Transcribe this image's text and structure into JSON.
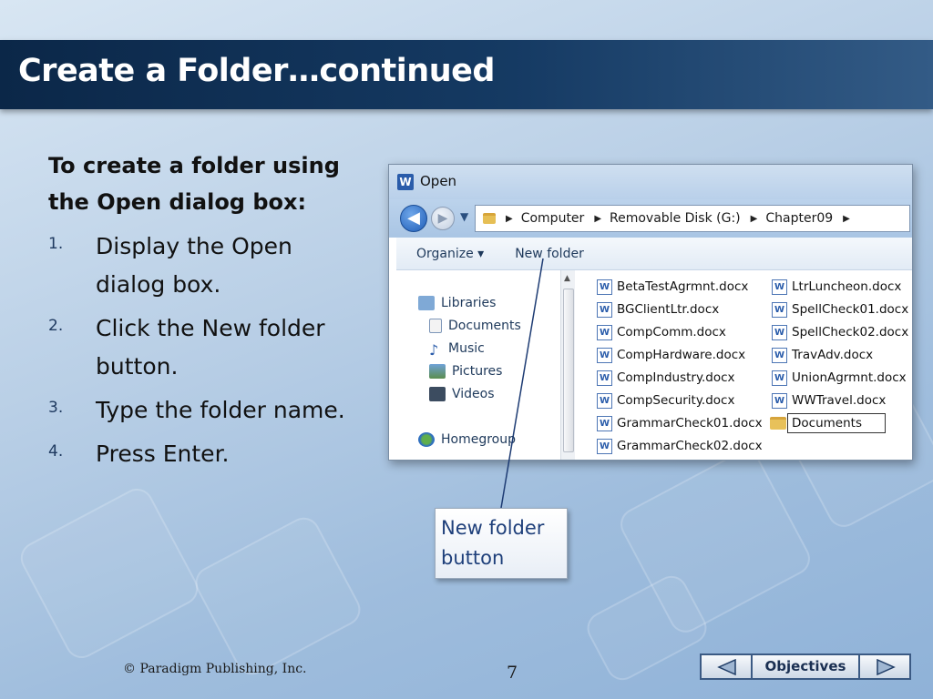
{
  "slide": {
    "title": "Create a Folder…continued",
    "intro": "To create a folder using the Open dialog box:",
    "steps": [
      {
        "num": "1.",
        "text": "Display the Open dialog box."
      },
      {
        "num": "2.",
        "text": "Click the New folder button."
      },
      {
        "num": "3.",
        "text": "Type the folder name."
      },
      {
        "num": "4.",
        "text": "Press Enter."
      }
    ],
    "callout": "New folder button",
    "copyright": "© Paradigm Publishing, Inc.",
    "page_number": "7",
    "objectives_label": "Objectives"
  },
  "dialog": {
    "title": "Open",
    "breadcrumbs": [
      "Computer",
      "Removable Disk (G:)",
      "Chapter09"
    ],
    "toolbar": {
      "organize": "Organize ▾",
      "new_folder": "New folder"
    },
    "nav_items": [
      "Libraries",
      "Documents",
      "Music",
      "Pictures",
      "Videos",
      "Homegroup"
    ],
    "files_col1": [
      "BetaTestAgrmnt.docx",
      "BGClientLtr.docx",
      "CompComm.docx",
      "CompHardware.docx",
      "CompIndustry.docx",
      "CompSecurity.docx",
      "GrammarCheck01.docx",
      "GrammarCheck02.docx"
    ],
    "files_col2": [
      "LtrLuncheon.docx",
      "SpellCheck01.docx",
      "SpellCheck02.docx",
      "TravAdv.docx",
      "UnionAgrmnt.docx",
      "WWTravel.docx"
    ],
    "new_folder_name": "Documents"
  },
  "colors": {
    "title_bar": "#0b2748",
    "callout_text": "#1e3f7a",
    "accent": "#2a5caa"
  }
}
